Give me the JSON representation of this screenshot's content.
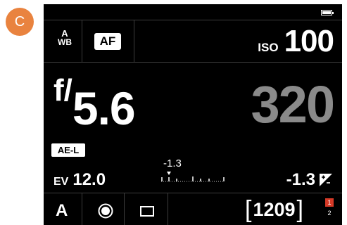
{
  "badge": {
    "letter": "C"
  },
  "top_row": {
    "wb_line1": "A",
    "wb_line2": "WB",
    "af_label": "AF",
    "iso_label": "ISO",
    "iso_value": "100"
  },
  "exposure": {
    "aperture_prefix": "f/",
    "aperture_value": "5.6",
    "shutter_value": "320"
  },
  "status": {
    "ae_lock_label": "AE-L",
    "meter_value": "-1.3",
    "ev_label": "EV",
    "ev_value": "12.0",
    "exp_comp_value": "-1.3",
    "exp_comp_icon": "exposure-compensation-icon"
  },
  "bottom_row": {
    "mode": "A",
    "metering_icon": "spot-metering-icon",
    "drive_icon": "single-frame-icon",
    "shots_open": "[",
    "shots_remaining": "1209",
    "shots_close": "]",
    "slot_active": "1",
    "slot_inactive": "2"
  },
  "colors": {
    "badge": "#e9833f",
    "shutter_dim": "#8a8a8a",
    "slot_active": "#d63a27"
  }
}
